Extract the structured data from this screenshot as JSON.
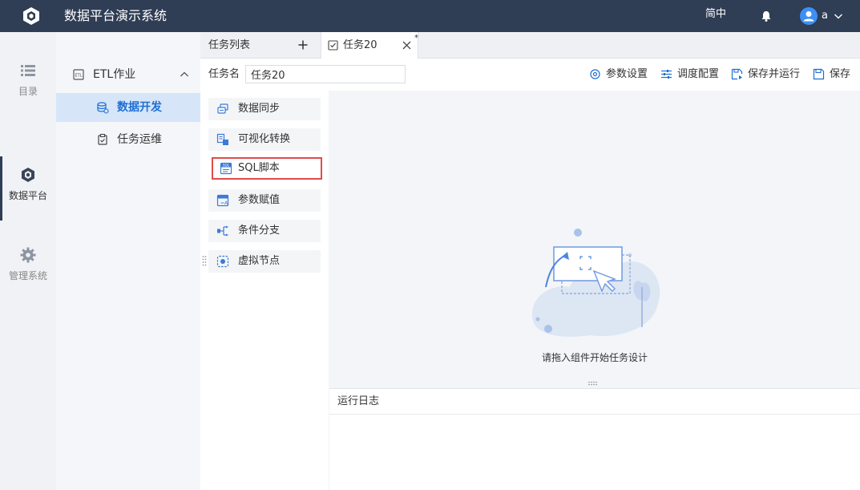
{
  "app": {
    "title": "数据平台演示系统"
  },
  "header": {
    "lang": "简中",
    "user": "a"
  },
  "rail": {
    "items": [
      {
        "label": "目录",
        "icon": "list-icon"
      },
      {
        "label": "数据平台",
        "icon": "cube-icon"
      },
      {
        "label": "管理系统",
        "icon": "gear-icon"
      }
    ]
  },
  "subnav": {
    "group": "ETL作业",
    "items": [
      {
        "label": "数据开发",
        "icon": "database-icon",
        "active": true
      },
      {
        "label": "任务运维",
        "icon": "clipboard-icon",
        "active": false
      }
    ]
  },
  "tabs": {
    "list_label": "任务列表",
    "active_tab": "任务20",
    "modified_mark": "*"
  },
  "toolbar": {
    "name_label": "任务名",
    "name_value": "任务20",
    "buttons": [
      {
        "label": "参数设置",
        "icon": "settings-icon"
      },
      {
        "label": "调度配置",
        "icon": "sliders-icon"
      },
      {
        "label": "保存并运行",
        "icon": "save-run-icon"
      },
      {
        "label": "保存",
        "icon": "save-icon"
      }
    ]
  },
  "components": [
    {
      "label": "数据同步",
      "icon": "sync-icon"
    },
    {
      "label": "可视化转换",
      "icon": "transform-icon"
    },
    {
      "label": "SQL脚本",
      "icon": "sql-icon",
      "selected": true
    },
    {
      "label": "参数赋值",
      "icon": "param-icon"
    },
    {
      "label": "条件分支",
      "icon": "branch-icon"
    },
    {
      "label": "虚拟节点",
      "icon": "virtual-node-icon"
    }
  ],
  "canvas": {
    "hint": "请拖入组件开始任务设计"
  },
  "log": {
    "title": "运行日志"
  },
  "colors": {
    "topbar": "#2f3d55",
    "accent": "#1f6ed4",
    "selected_border": "#e04b4b",
    "active_nav_bg": "#d6e6f8"
  }
}
